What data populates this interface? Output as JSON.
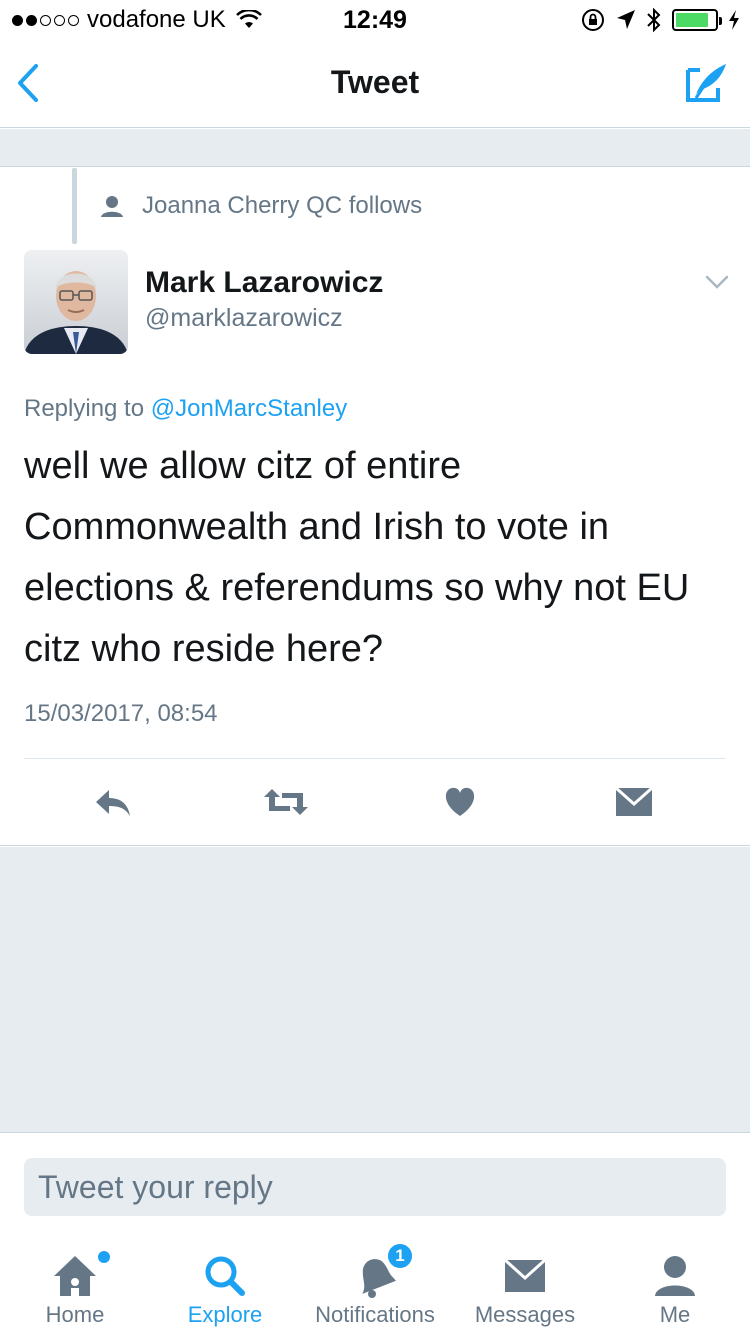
{
  "status_bar": {
    "carrier": "vodafone UK",
    "time": "12:49",
    "battery_level": 0.85,
    "icons": [
      "wifi-icon",
      "lock-rotation-icon",
      "location-icon",
      "bluetooth-icon",
      "battery-icon",
      "charging-icon"
    ]
  },
  "nav": {
    "title": "Tweet",
    "back_icon": "chevron-left-icon",
    "compose_icon": "compose-tweet-icon"
  },
  "tweet": {
    "social_context": "Joanna Cherry QC follows",
    "author_name": "Mark Lazarowicz",
    "author_handle": "@marklazarowicz",
    "replying_prefix": "Replying to",
    "replying_to": "@JonMarcStanley",
    "text": "well we allow citz of entire Commonwealth and Irish to vote in elections & referendums so why not EU citz who reside here?",
    "timestamp": "15/03/2017, 08:54",
    "actions": [
      "reply-icon",
      "retweet-icon",
      "like-icon",
      "direct-message-icon"
    ]
  },
  "composer": {
    "placeholder": "Tweet your reply"
  },
  "tab_bar": {
    "tabs": [
      {
        "label": "Home",
        "icon": "home-icon"
      },
      {
        "label": "Explore",
        "icon": "search-icon",
        "active": true
      },
      {
        "label": "Notifications",
        "icon": "bell-icon",
        "badge": "1"
      },
      {
        "label": "Messages",
        "icon": "envelope-icon"
      },
      {
        "label": "Me",
        "icon": "profile-icon"
      }
    ]
  },
  "colors": {
    "accent": "#1da1f2",
    "secondary_text": "#657786",
    "background_gray": "#e6ecf0",
    "action_gray": "#657786"
  }
}
